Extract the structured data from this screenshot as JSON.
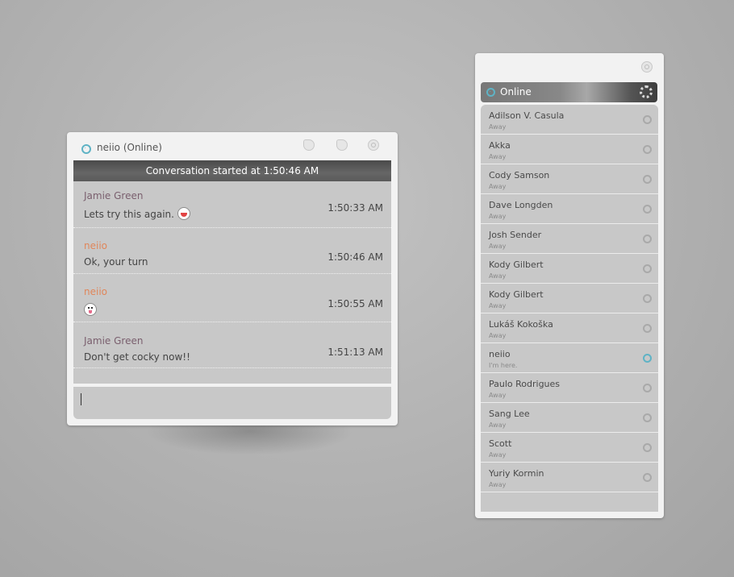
{
  "chat_window": {
    "title": "neiio (Online)",
    "conversation_banner": "Conversation started at 1:50:46 AM",
    "messages": [
      {
        "sender": "Jamie Green",
        "text": "Lets try this again.",
        "emoticon": "laughing-face-icon",
        "time": "1:50:33 AM"
      },
      {
        "sender": "neiio",
        "text": "Ok, your turn",
        "emoticon": "",
        "time": "1:50:46 AM"
      },
      {
        "sender": "neiio",
        "text": "",
        "emoticon": "tongue-face-icon",
        "time": "1:50:55 AM"
      },
      {
        "sender": "Jamie Green",
        "text": "Don't get cocky now!!",
        "emoticon": "",
        "time": "1:51:13 AM"
      }
    ],
    "input_value": ""
  },
  "contacts_window": {
    "group_label": "Online",
    "contacts": [
      {
        "name": "Adilson V. Casula",
        "status": "Away",
        "online": false
      },
      {
        "name": "Akka",
        "status": "Away",
        "online": false
      },
      {
        "name": "Cody Samson",
        "status": "Away",
        "online": false
      },
      {
        "name": "Dave Longden",
        "status": "Away",
        "online": false
      },
      {
        "name": "Josh Sender",
        "status": "Away",
        "online": false
      },
      {
        "name": "Kody Gilbert",
        "status": "Away",
        "online": false
      },
      {
        "name": "Kody Gilbert",
        "status": "Away",
        "online": false
      },
      {
        "name": "Lukáš Kokoška",
        "status": "Away",
        "online": false
      },
      {
        "name": "neiio",
        "status": "I'm here.",
        "online": true
      },
      {
        "name": "Paulo Rodrigues",
        "status": "Away",
        "online": false
      },
      {
        "name": "Sang Lee",
        "status": "Away",
        "online": false
      },
      {
        "name": "Scott",
        "status": "Away",
        "online": false
      },
      {
        "name": "Yuriy Kormin",
        "status": "Away",
        "online": false
      }
    ]
  },
  "colors": {
    "status_online": "#5fb3c5",
    "status_away": "#a9a9a9",
    "sender_jamie": "#7a5f6e",
    "sender_neiio": "#e0865a"
  }
}
